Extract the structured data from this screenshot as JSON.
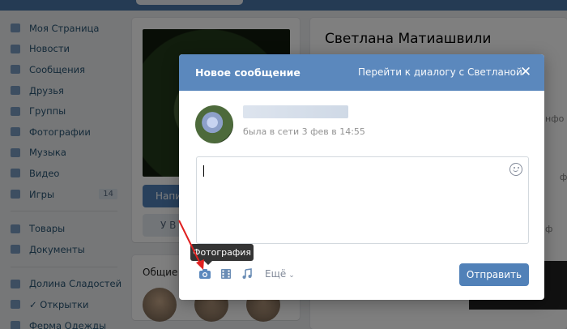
{
  "left_menu": {
    "items": [
      {
        "label": "Моя Страница",
        "icon": "home-icon"
      },
      {
        "label": "Новости",
        "icon": "news-icon"
      },
      {
        "label": "Сообщения",
        "icon": "messages-icon"
      },
      {
        "label": "Друзья",
        "icon": "friends-icon"
      },
      {
        "label": "Группы",
        "icon": "groups-icon"
      },
      {
        "label": "Фотографии",
        "icon": "camera-icon"
      },
      {
        "label": "Музыка",
        "icon": "music-icon"
      },
      {
        "label": "Видео",
        "icon": "video-icon"
      },
      {
        "label": "Игры",
        "icon": "games-icon",
        "badge": "14"
      }
    ],
    "items2": [
      {
        "label": "Товары",
        "icon": "bag-icon"
      },
      {
        "label": "Документы",
        "icon": "document-icon"
      }
    ],
    "items3": [
      {
        "label": "Долина Сладостей",
        "icon": "community-icon"
      },
      {
        "label": "✓ Открытки",
        "icon": "community-icon"
      },
      {
        "label": "Ферма Одежды",
        "icon": "community-icon"
      }
    ]
  },
  "profile": {
    "primary_button": "Напи",
    "secondary_button": "У В",
    "friends_title": "Общие д"
  },
  "right": {
    "name": "Светлана Матиашвили",
    "frag1": "нфо",
    "frag2": "ф",
    "frag3": "ф"
  },
  "modal": {
    "title": "Новое сообщение",
    "dialog_link": "Перейти к диалогу с Светланой",
    "status": "была в сети 3 фев в 14:55",
    "more_label": "Ещё",
    "send_label": "Отправить",
    "tooltip": "Фотография"
  },
  "colors": {
    "header": "#5b88bd",
    "button": "#5181b8",
    "arrow": "#e02020"
  }
}
